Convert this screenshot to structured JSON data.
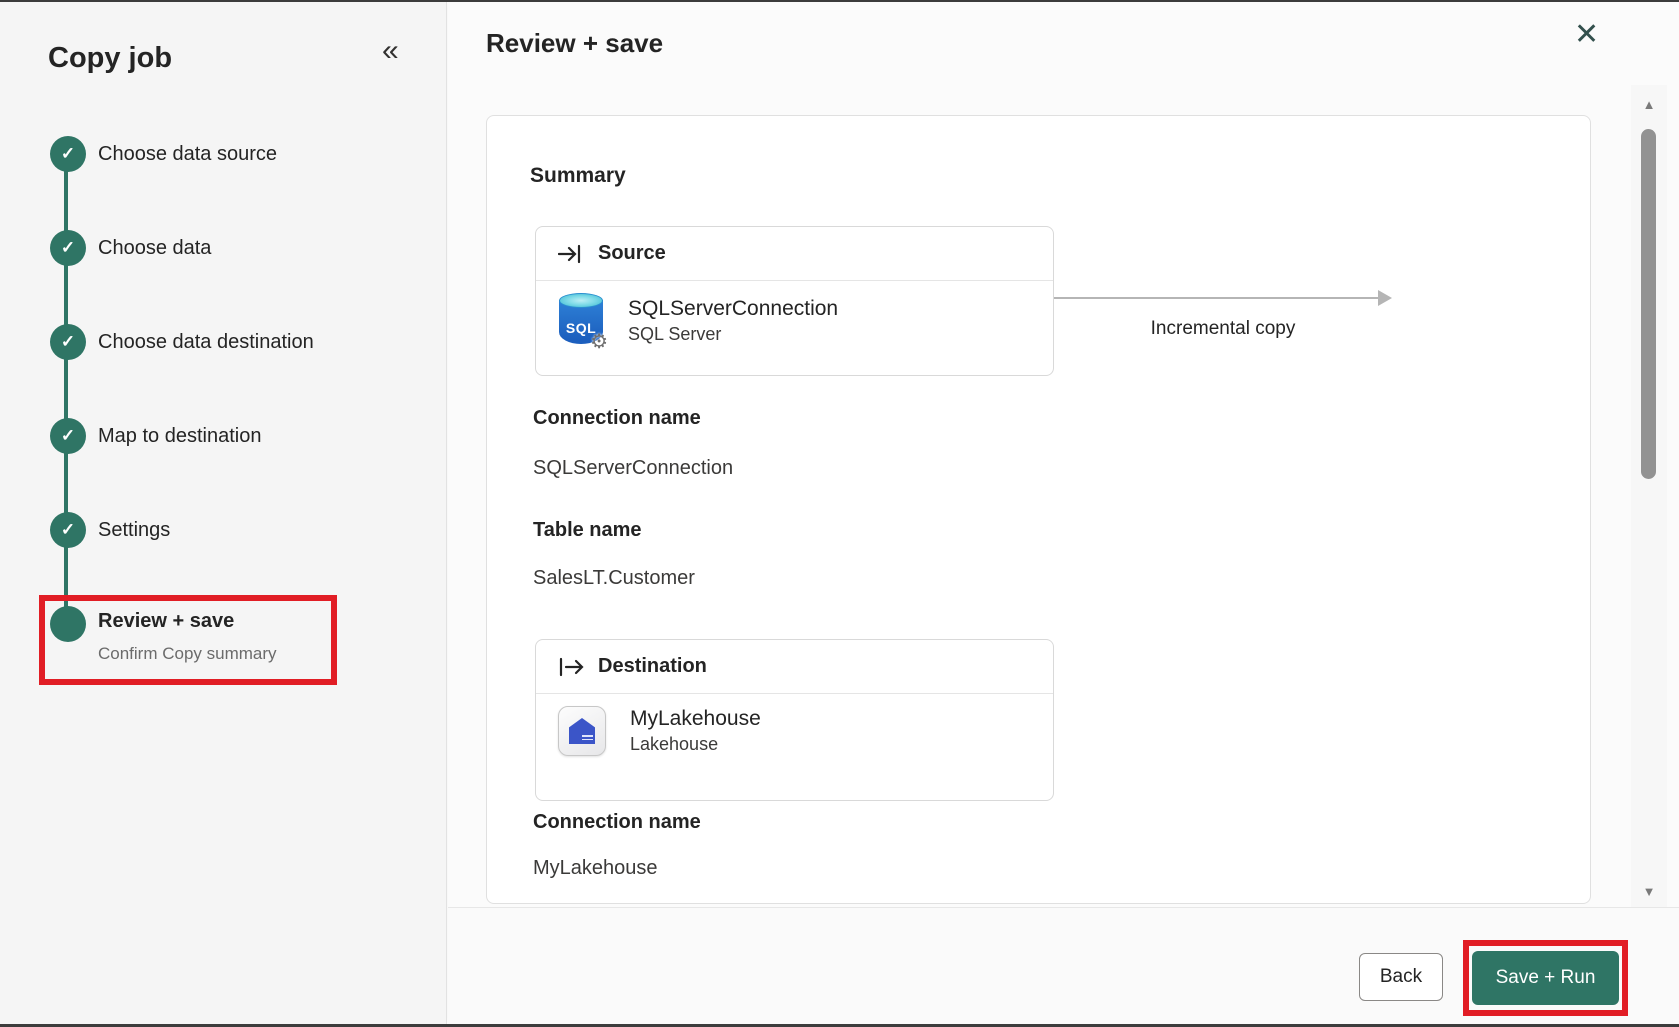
{
  "sidebar": {
    "title": "Copy job",
    "collapse_icon": "«",
    "check_icon": "✓",
    "steps": [
      {
        "label": "Choose data source"
      },
      {
        "label": "Choose data"
      },
      {
        "label": "Choose data destination"
      },
      {
        "label": "Map to destination"
      },
      {
        "label": "Settings"
      },
      {
        "label": "Review + save",
        "sublabel": "Confirm Copy summary"
      }
    ],
    "current_step": "Review + save"
  },
  "header": {
    "title": "Review + save",
    "close_icon": "✕"
  },
  "summary": {
    "heading": "Summary",
    "source": {
      "section_label": "Source",
      "connection_name": "SQLServerConnection",
      "connection_type": "SQL Server",
      "icon_text": "SQL",
      "gear_icon": "⚙"
    },
    "copy_mode": "Incremental copy",
    "source_fields": [
      {
        "label": "Connection name",
        "value": "SQLServerConnection"
      },
      {
        "label": "Table name",
        "value": "SalesLT.Customer"
      }
    ],
    "destination": {
      "section_label": "Destination",
      "connection_name": "MyLakehouse",
      "connection_type": "Lakehouse"
    },
    "destination_fields": [
      {
        "label": "Connection name",
        "value": "MyLakehouse"
      }
    ]
  },
  "scrollbar": {
    "up_icon": "▲",
    "down_icon": "▼"
  },
  "footer": {
    "back_label": "Back",
    "save_run_label": "Save + Run"
  },
  "colors": {
    "accent_green": "#2f7565",
    "highlight_red": "#e11d25",
    "sql_icon_blue": "#2e80d6",
    "lakehouse_blue": "#3b55c8"
  }
}
